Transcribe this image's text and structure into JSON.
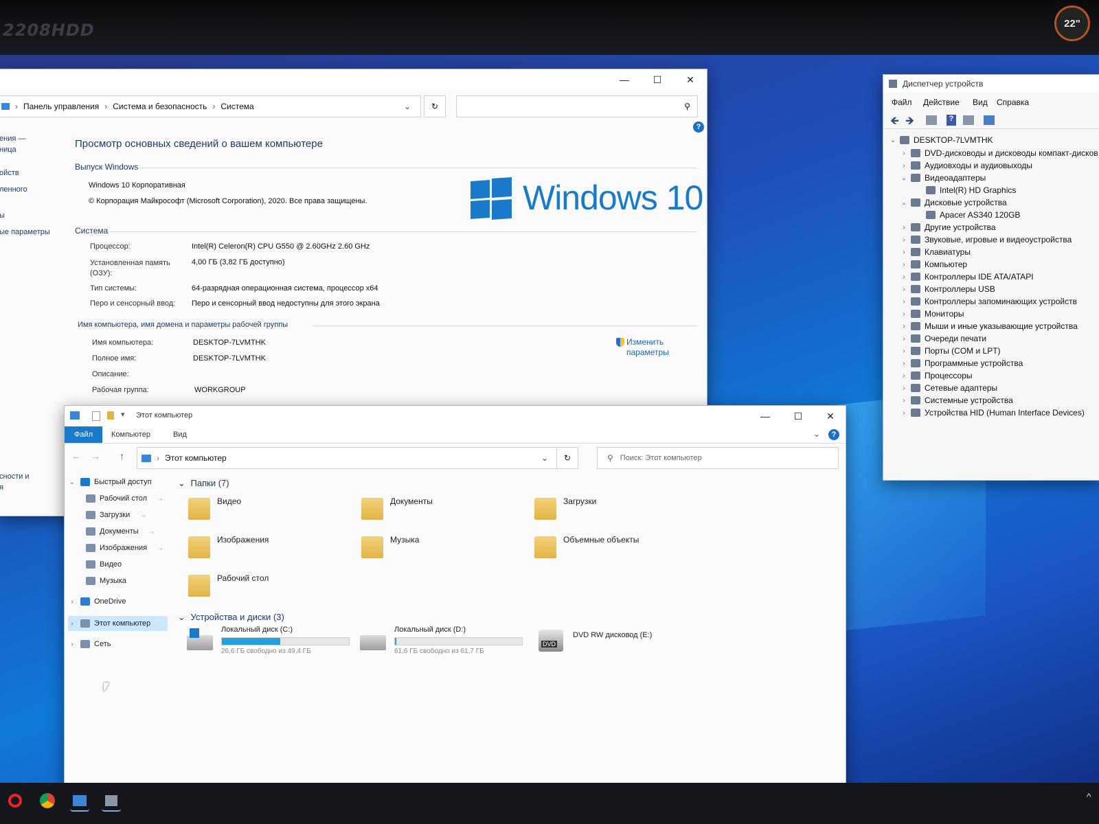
{
  "monitor": {
    "brand": "2208HDD",
    "badge": "22\""
  },
  "system_window": {
    "breadcrumb": [
      "Панель управления",
      "Система и безопасность",
      "Система"
    ],
    "left_nav": [
      "ения —",
      "ница",
      "ойств",
      "ленного",
      "ы",
      "ые параметры",
      "сности и",
      "я"
    ],
    "heading": "Просмотр основных сведений о вашем компьютере",
    "edition_section": "Выпуск Windows",
    "edition": "Windows 10 Корпоративная",
    "copyright": "© Корпорация Майкрософт (Microsoft Corporation), 2020. Все права защищены.",
    "logo_text": "Windows 10",
    "system_section": "Система",
    "rows": [
      {
        "label": "Процессор:",
        "value": "Intel(R) Celeron(R) CPU G550 @ 2.60GHz   2.60 GHz"
      },
      {
        "label": "Установленная память (ОЗУ):",
        "value": "4,00 ГБ (3,82 ГБ доступно)"
      },
      {
        "label": "Тип системы:",
        "value": "64-разрядная операционная система, процессор x64"
      },
      {
        "label": "Перо и сенсорный ввод:",
        "value": "Перо и сенсорный ввод недоступны для этого экрана"
      }
    ],
    "name_section": "Имя компьютера, имя домена и параметры рабочей группы",
    "name_rows": [
      {
        "label": "Имя компьютера:",
        "value": "DESKTOP-7LVMTHK"
      },
      {
        "label": "Полное имя:",
        "value": "DESKTOP-7LVMTHK"
      },
      {
        "label": "Описание:",
        "value": ""
      },
      {
        "label": "Рабочая группа:",
        "value": "WORKGROUP"
      }
    ],
    "change_link": "Изменить параметры"
  },
  "device_manager": {
    "title": "Диспетчер устройств",
    "menu": [
      "Файл",
      "Действие",
      "Вид",
      "Справка"
    ],
    "root": "DESKTOP-7LVMTHK",
    "items": [
      {
        "label": "DVD-дисководы и дисководы компакт-дисков",
        "level": 1,
        "state": "collapsed"
      },
      {
        "label": "Аудиовходы и аудиовыходы",
        "level": 1,
        "state": "collapsed"
      },
      {
        "label": "Видеоадаптеры",
        "level": 1,
        "state": "expanded"
      },
      {
        "label": "Intel(R) HD Graphics",
        "level": 2,
        "state": "leaf"
      },
      {
        "label": "Дисковые устройства",
        "level": 1,
        "state": "expanded"
      },
      {
        "label": "Apacer AS340 120GB",
        "level": 2,
        "state": "leaf"
      },
      {
        "label": "Другие устройства",
        "level": 1,
        "state": "collapsed"
      },
      {
        "label": "Звуковые, игровые и видеоустройства",
        "level": 1,
        "state": "collapsed"
      },
      {
        "label": "Клавиатуры",
        "level": 1,
        "state": "collapsed"
      },
      {
        "label": "Компьютер",
        "level": 1,
        "state": "collapsed"
      },
      {
        "label": "Контроллеры IDE ATA/ATAPI",
        "level": 1,
        "state": "collapsed"
      },
      {
        "label": "Контроллеры USB",
        "level": 1,
        "state": "collapsed"
      },
      {
        "label": "Контроллеры запоминающих устройств",
        "level": 1,
        "state": "collapsed"
      },
      {
        "label": "Мониторы",
        "level": 1,
        "state": "collapsed"
      },
      {
        "label": "Мыши и иные указывающие устройства",
        "level": 1,
        "state": "collapsed"
      },
      {
        "label": "Очереди печати",
        "level": 1,
        "state": "collapsed"
      },
      {
        "label": "Порты (COM и LPT)",
        "level": 1,
        "state": "collapsed"
      },
      {
        "label": "Программные устройства",
        "level": 1,
        "state": "collapsed"
      },
      {
        "label": "Процессоры",
        "level": 1,
        "state": "collapsed"
      },
      {
        "label": "Сетевые адаптеры",
        "level": 1,
        "state": "collapsed"
      },
      {
        "label": "Системные устройства",
        "level": 1,
        "state": "collapsed"
      },
      {
        "label": "Устройства HID (Human Interface Devices)",
        "level": 1,
        "state": "collapsed"
      }
    ]
  },
  "explorer": {
    "title": "Этот компьютер",
    "ribbon_tabs": [
      "Файл",
      "Компьютер",
      "Вид"
    ],
    "address": "Этот компьютер",
    "search_placeholder": "Поиск: Этот компьютер",
    "nav": [
      {
        "label": "Быстрый доступ",
        "pinned": false,
        "level": 0
      },
      {
        "label": "Рабочий стол",
        "pinned": true,
        "level": 1
      },
      {
        "label": "Загрузки",
        "pinned": true,
        "level": 1
      },
      {
        "label": "Документы",
        "pinned": true,
        "level": 1
      },
      {
        "label": "Изображения",
        "pinned": true,
        "level": 1
      },
      {
        "label": "Видео",
        "pinned": false,
        "level": 1
      },
      {
        "label": "Музыка",
        "pinned": false,
        "level": 1
      },
      {
        "label": "OneDrive",
        "pinned": false,
        "level": 0
      },
      {
        "label": "Этот компьютер",
        "pinned": false,
        "level": 0
      },
      {
        "label": "Сеть",
        "pinned": false,
        "level": 0
      }
    ],
    "folders_header": "Папки (7)",
    "folders": [
      "Видео",
      "Документы",
      "Загрузки",
      "Изображения",
      "Музыка",
      "Объемные объекты",
      "Рабочий стол"
    ],
    "devices_header": "Устройства и диски (3)",
    "drives": [
      {
        "name": "Локальный диск (C:)",
        "info": "26,6 ГБ свободно из 49,4 ГБ",
        "used_fraction": 0.46
      },
      {
        "name": "Локальный диск (D:)",
        "info": "61,6 ГБ свободно из 61,7 ГБ",
        "used_fraction": 0.01
      },
      {
        "name": "DVD RW дисковод (E:)",
        "info": "",
        "used_fraction": null
      }
    ],
    "dvd_label": "DVD"
  },
  "colors": {
    "accent": "#1979ca",
    "drive_bar": "#26a0da"
  }
}
